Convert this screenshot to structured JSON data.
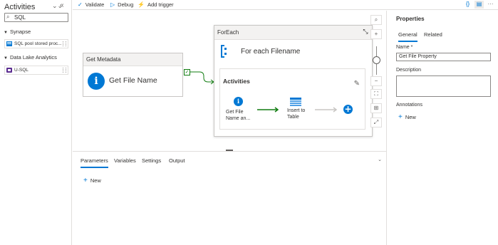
{
  "activities": {
    "title": "Activities",
    "search_value": "SQL",
    "categories": [
      {
        "label": "Synapse",
        "items": [
          {
            "label": "SQL pool stored proc..."
          }
        ]
      },
      {
        "label": "Data Lake Analytics",
        "items": [
          {
            "label": "U-SQL"
          }
        ]
      }
    ]
  },
  "toolbar": {
    "validate": "Validate",
    "debug": "Debug",
    "add_trigger": "Add trigger"
  },
  "canvas": {
    "get_metadata": {
      "header": "Get Metadata",
      "label": "Get File Name"
    },
    "foreach": {
      "header": "ForEach",
      "title": "For each Filename",
      "activities_title": "Activities",
      "inner_get_file": "Get File Name an...",
      "inner_insert": "Insert to Table"
    }
  },
  "bottom_panel": {
    "tabs": [
      "Parameters",
      "Variables",
      "Settings",
      "Output"
    ],
    "new_label": "New"
  },
  "properties": {
    "title": "Properties",
    "tabs": [
      "General",
      "Related"
    ],
    "name_label": "Name *",
    "name_value": "Get File Property",
    "description_label": "Description",
    "annotations_label": "Annotations",
    "new_label": "New"
  },
  "colors": {
    "accent": "#0078d4",
    "success": "#107c10",
    "border": "#e1dfdd"
  }
}
